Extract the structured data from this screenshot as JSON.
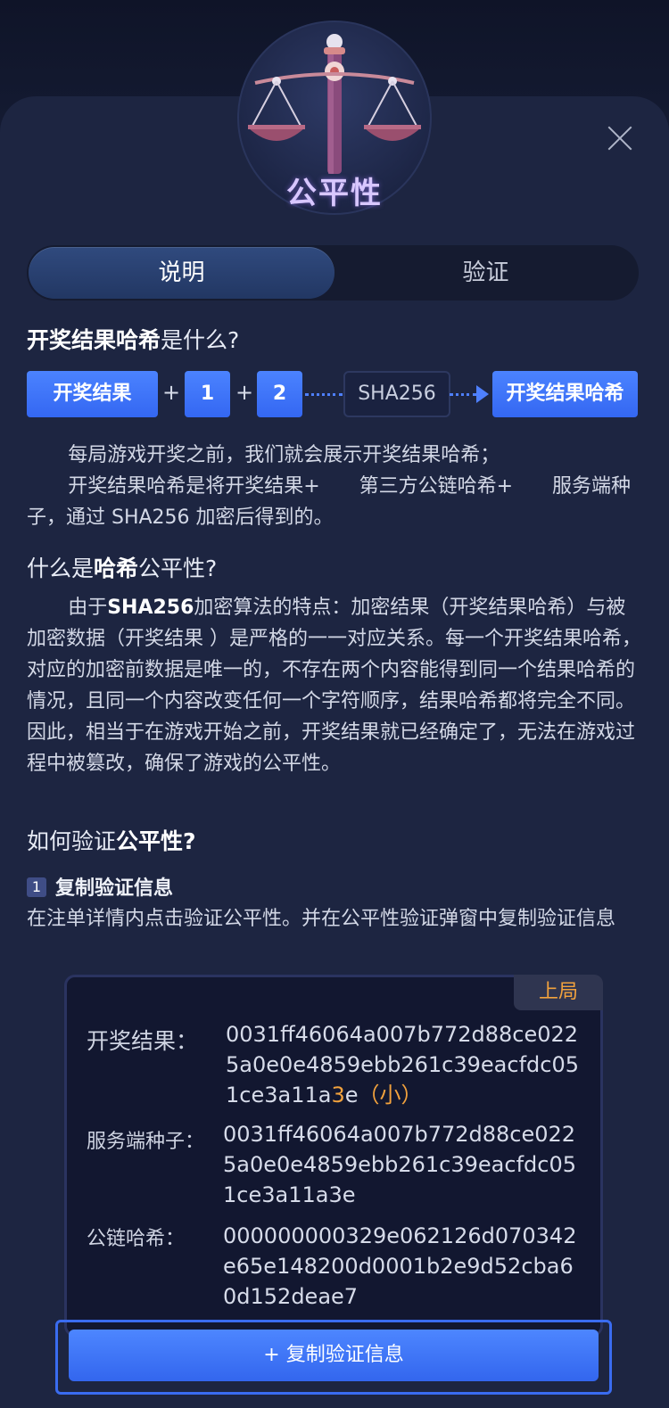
{
  "header": {
    "title": "公平性"
  },
  "tabs": {
    "explain": "说明",
    "verify": "验证"
  },
  "section1": {
    "title_bold": "开奖结果哈希",
    "title_rest": "是什么?"
  },
  "formula": {
    "box1": "开奖结果",
    "plus": "+",
    "box2": "1",
    "box3": "2",
    "sha": "SHA256",
    "result": "开奖结果哈希"
  },
  "intro": {
    "p1": "每局游戏开奖之前，我们就会展示开奖结果哈希；",
    "p2": "开奖结果哈希是将开奖结果+　　第三方公链哈希+　　服务端种子，通过 SHA256 加密后得到的。"
  },
  "section2": {
    "title_pre": "什么是",
    "title_bold": "哈希",
    "title_post": "公平性?"
  },
  "fairness": {
    "p1_bold": "SHA256",
    "p1_pre": "由于",
    "p1_post": "加密算法的特点：加密结果（开奖结果哈希）与被加密数据（开奖结果 ）是严格的一一对应关系。每一个开奖结果哈希，对应的加密前数据是唯一的，不存在两个内容能得到同一个结果哈希的情况，且同一个内容改变任何一个字符顺序，结果哈希都将完全不同。",
    "p2": "因此，相当于在游戏开始之前，开奖结果就已经确定了，无法在游戏过程中被篡改，确保了游戏的公平性。"
  },
  "section3": {
    "title_pre": "如何验证",
    "title_bold": "公平性?"
  },
  "step1": {
    "number": "1",
    "title": "复制验证信息",
    "desc": "在注单详情内点击验证公平性。并在公平性验证弹窗中复制验证信息"
  },
  "card": {
    "tag": "上局",
    "result_label": "开奖结果：",
    "result_value_a": "0031ff46064a007b772d88ce0225a0e0e4859ebb261c39eacfdc051ce3a11a",
    "result_value_hl": "3",
    "result_value_b": "e",
    "result_note": "（小）",
    "seed_label": "服务端种子：",
    "seed_value": "0031ff46064a007b772d88ce0225a0e0e4859ebb261c39eacfdc051ce3a11a3e",
    "chain_label": "公链哈希：",
    "chain_value": "000000000329e062126d070342e65e148200d0001b2e9d52cba60d152deae7"
  },
  "copy_button": {
    "label": "+ 复制验证信息"
  },
  "colors": {
    "accent_blue": "#3a6cf0",
    "highlight_orange": "#f2a23d",
    "panel_bg": "#1d2541"
  }
}
